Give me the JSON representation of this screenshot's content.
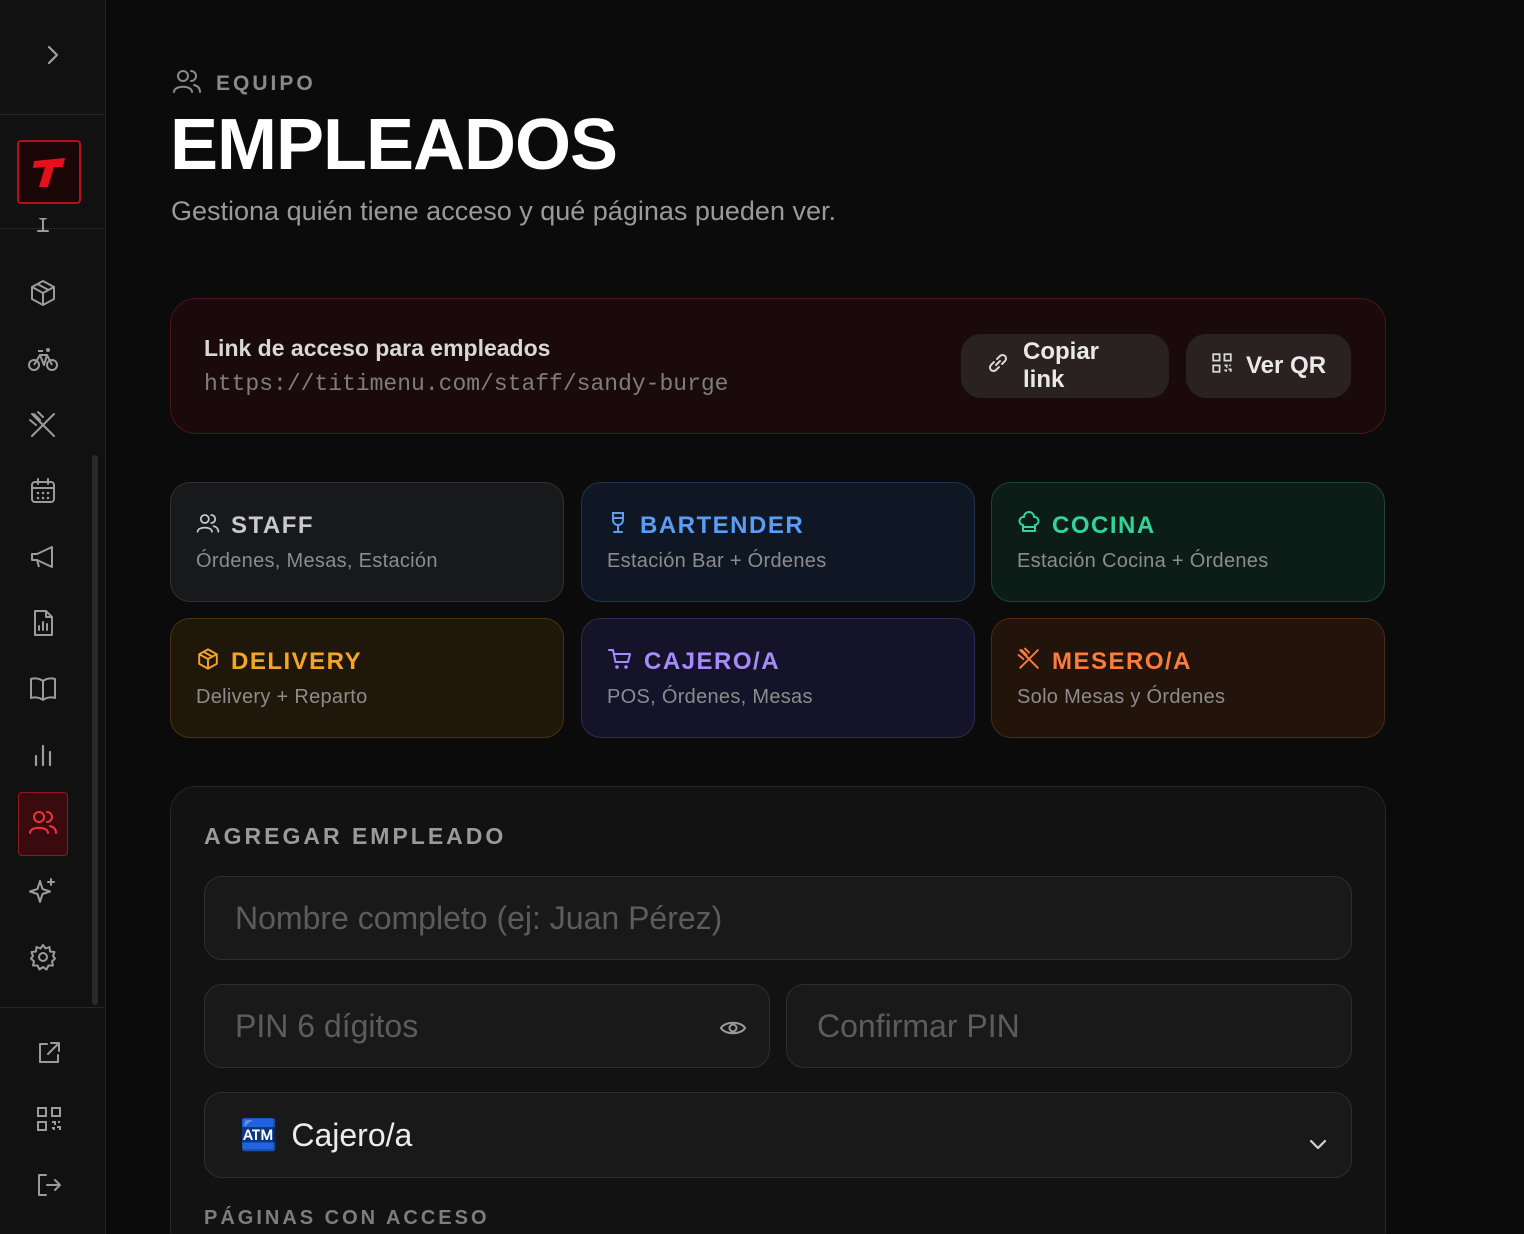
{
  "sidebar": {
    "logo_letter": "T",
    "colors": {
      "brand": "#e3111b",
      "active_bg": "#3a0b0e",
      "icon": "#9b9b9b"
    },
    "items": [
      {
        "icon": "wine-glass-icon"
      },
      {
        "icon": "box-icon"
      },
      {
        "icon": "bicycle-icon"
      },
      {
        "icon": "utensils-crossed-icon"
      },
      {
        "icon": "calendar-icon"
      },
      {
        "icon": "megaphone-icon"
      },
      {
        "icon": "report-icon"
      },
      {
        "icon": "book-icon"
      },
      {
        "icon": "bar-chart-icon"
      },
      {
        "icon": "users-icon",
        "active": true
      },
      {
        "icon": "sparkles-icon"
      },
      {
        "icon": "settings-icon"
      }
    ],
    "bottom": [
      {
        "icon": "external-link-icon"
      },
      {
        "icon": "qr-code-icon"
      },
      {
        "icon": "logout-icon"
      }
    ]
  },
  "header": {
    "breadcrumb": "EQUIPO",
    "title": "EMPLEADOS",
    "subtitle": "Gestiona quién tiene acceso y qué páginas pueden ver."
  },
  "link_card": {
    "title": "Link de acceso para empleados",
    "url": "https://titimenu.com/staff/sandy-burge",
    "copy_label": "Copiar link",
    "qr_label": "Ver QR"
  },
  "roles": [
    {
      "name": "STAFF",
      "desc": "Órdenes, Mesas, Estación",
      "color": "#c9c9c9",
      "icon": "users-icon"
    },
    {
      "name": "BARTENDER",
      "desc": "Estación Bar + Órdenes",
      "color": "#5b9cf5",
      "icon": "wine-glass-icon"
    },
    {
      "name": "COCINA",
      "desc": "Estación Cocina + Órdenes",
      "color": "#34d399",
      "icon": "chef-hat-icon"
    },
    {
      "name": "DELIVERY",
      "desc": "Delivery + Reparto",
      "color": "#f5a524",
      "icon": "box-icon"
    },
    {
      "name": "CAJERO/A",
      "desc": "POS, Órdenes, Mesas",
      "color": "#a78bfa",
      "icon": "cart-icon"
    },
    {
      "name": "MESERO/A",
      "desc": "Solo Mesas y Órdenes",
      "color": "#fb7c3c",
      "icon": "utensils-crossed-icon"
    }
  ],
  "add_employee": {
    "section_label": "AGREGAR EMPLEADO",
    "name_placeholder": "Nombre completo (ej: Juan Pérez)",
    "pin_placeholder": "PIN 6 dígitos",
    "confirm_placeholder": "Confirmar PIN",
    "role_emoji": "🏧",
    "role_selected": "Cajero/a",
    "pages_label": "PÁGINAS CON ACCESO"
  }
}
